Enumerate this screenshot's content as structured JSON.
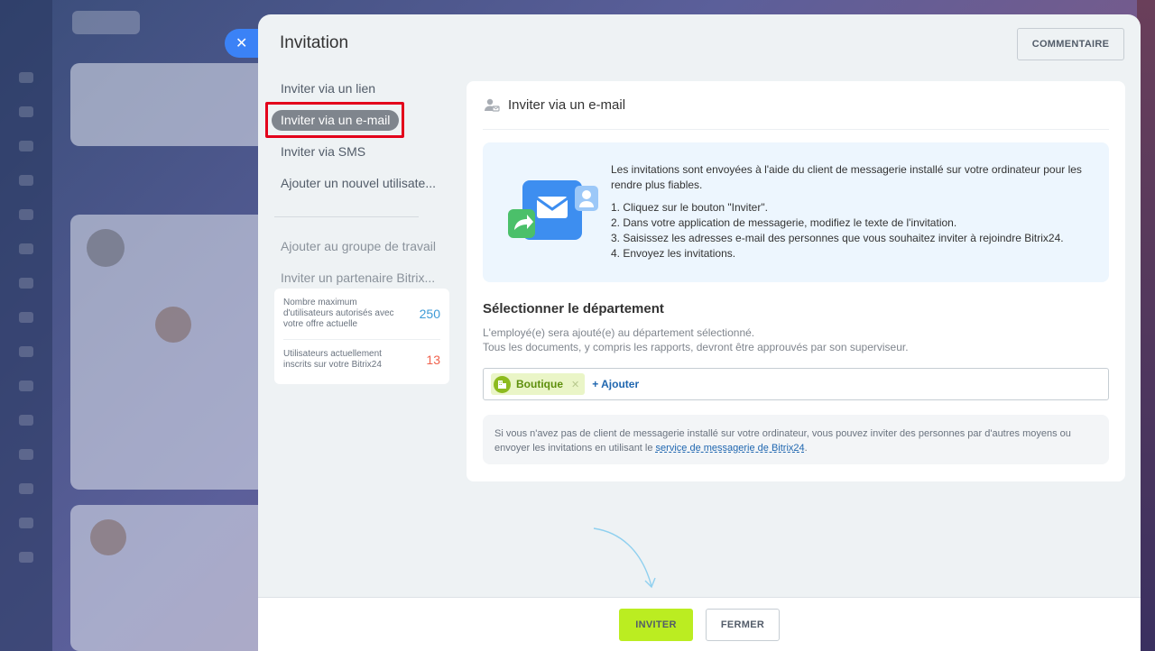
{
  "slider": {
    "title": "Invitation",
    "comment_button": "COMMENTAIRE"
  },
  "menu": {
    "items": [
      {
        "label": "Inviter via un lien"
      },
      {
        "label": "Inviter via un e-mail",
        "active": true
      },
      {
        "label": "Inviter via SMS"
      },
      {
        "label": "Ajouter un nouvel utilisate..."
      }
    ],
    "secondary": [
      {
        "label": "Ajouter au groupe de travail"
      },
      {
        "label": "Inviter un partenaire Bitrix..."
      }
    ]
  },
  "limits": {
    "max_label": "Nombre maximum d'utilisateurs autorisés avec votre offre actuelle",
    "max_value": "250",
    "current_label": "Utilisateurs actuellement inscrits sur votre Bitrix24",
    "current_value": "13"
  },
  "card": {
    "header": "Inviter via un e-mail",
    "info_intro": "Les invitations sont envoyées à l'aide du client de messagerie installé sur votre ordinateur pour les rendre plus fiables.",
    "steps": [
      "1. Cliquez sur le bouton \"Inviter\".",
      "2. Dans votre application de messagerie, modifiez le texte de l'invitation.",
      "3. Saisissez les adresses e-mail des personnes que vous souhaitez inviter à rejoindre Bitrix24.",
      "4. Envoyez les invitations."
    ],
    "department_title": "Sélectionner le département",
    "department_desc_1": "L'employé(e) sera ajouté(e) au département sélectionné.",
    "department_desc_2": "Tous les documents, y compris les rapports, devront être approuvés par son superviseur.",
    "selected_department": "Boutique",
    "add_label": "+ Ajouter",
    "note_text": "Si vous n'avez pas de client de messagerie installé sur votre ordinateur, vous pouvez inviter des personnes par d'autres moyens ou envoyer les invitations en utilisant le ",
    "note_link": "service de messagerie de Bitrix24",
    "note_end": "."
  },
  "footer": {
    "invite_button": "INVITER",
    "close_button": "FERMER"
  },
  "colors": {
    "accent_blue": "#3b82f6",
    "invite_green": "#bbed21",
    "highlight_red": "#e3001b"
  },
  "icons": {
    "close_tab": "close-icon",
    "card_header": "user-add-icon",
    "department_tag": "building-icon"
  }
}
